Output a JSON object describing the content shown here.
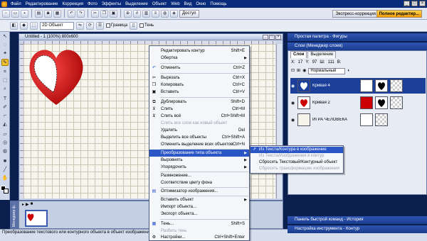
{
  "menubar": {
    "items": [
      "Файл",
      "Редактирование",
      "Коррекция",
      "Фото",
      "Эффекты",
      "Выделение",
      "Объект",
      "Web",
      "Вид",
      "Окно",
      "Помощь"
    ]
  },
  "toolbar": {
    "access_label": "Доступ",
    "express_label": "Экспресс-коррекция",
    "full_editor_label": "Полное редактир..."
  },
  "toolbar2": {
    "mode_value": "2D Объект",
    "border_label": "Граница",
    "shadow_label": "Тень"
  },
  "document": {
    "title": "Untitled - 1 (100%) 800x600"
  },
  "context_menu": {
    "items": [
      {
        "label": "Редактировать контур",
        "shortcut": "Shift+E",
        "disabled": false
      },
      {
        "label": "Обертка",
        "shortcut": "",
        "submenu": true,
        "disabled": false
      },
      {
        "label": "Отменить",
        "shortcut": "Ctrl+Z",
        "disabled": false
      },
      {
        "label": "Вырезать",
        "shortcut": "Ctrl+X",
        "disabled": false
      },
      {
        "label": "Копировать",
        "shortcut": "Ctrl+C",
        "disabled": false
      },
      {
        "label": "Вставить",
        "shortcut": "Ctrl+V",
        "disabled": false
      },
      {
        "label": "Дублировать",
        "shortcut": "Shift+D",
        "disabled": false
      },
      {
        "label": "Слить",
        "shortcut": "Ctrl+M",
        "disabled": false
      },
      {
        "label": "Слить всё",
        "shortcut": "Ctrl+Shift+M",
        "disabled": false
      },
      {
        "label": "Слить все слои как новый объект",
        "shortcut": "",
        "disabled": true
      },
      {
        "label": "Удалить",
        "shortcut": "Del",
        "disabled": false
      },
      {
        "label": "Выделить все объекты",
        "shortcut": "Ctrl+Shift+A",
        "disabled": false
      },
      {
        "label": "Отменить выделение всех объектов",
        "shortcut": "Ctrl+N",
        "disabled": false
      },
      {
        "label": "Преобразование типа объекта",
        "shortcut": "",
        "submenu": true,
        "highlighted": true,
        "disabled": false
      },
      {
        "label": "Выровнять",
        "shortcut": "",
        "submenu": true,
        "disabled": false
      },
      {
        "label": "Упорядочить",
        "shortcut": "",
        "submenu": true,
        "disabled": false
      },
      {
        "label": "Размножение...",
        "shortcut": "",
        "disabled": false
      },
      {
        "label": "Соответствие цвету фона",
        "shortcut": "",
        "disabled": false
      },
      {
        "label": "Оптимизатор изображения...",
        "shortcut": "",
        "disabled": false
      },
      {
        "label": "Вставить объект",
        "shortcut": "",
        "submenu": true,
        "disabled": false
      },
      {
        "label": "Импорт объекта...",
        "shortcut": "",
        "disabled": false
      },
      {
        "label": "Экспорт объекта...",
        "shortcut": "",
        "disabled": false
      },
      {
        "label": "Тень...",
        "shortcut": "Shift+S",
        "disabled": false
      },
      {
        "label": "Разбить тень",
        "shortcut": "",
        "disabled": true
      },
      {
        "label": "Настройки...",
        "shortcut": "Ctrl+Shift+Enter",
        "disabled": false
      }
    ]
  },
  "submenu": {
    "items": [
      {
        "label": "Из Текста/Контура в изображение",
        "highlighted": true,
        "disabled": false
      },
      {
        "label": "Из Текста/Изображения в контур",
        "disabled": true
      },
      {
        "label": "Сбросить Текстовый/Контурный объект",
        "disabled": false
      },
      {
        "label": "Сбросить трансформацию изображения",
        "disabled": true
      }
    ]
  },
  "panels": {
    "palette_title": "Простая палитра - Фигуры",
    "layers_title": "Слои (Менеджер слоев)",
    "tab_layers": "Слои",
    "tab_selection": "Выделение",
    "x_label": "X:",
    "x_value": "17",
    "y_label": "Y:",
    "y_value": "97",
    "w_label": "Ш:",
    "w_value": "111",
    "h_label": "В:",
    "blend_mode": "Нормальный",
    "history_title": "Панель быстрой команд - История",
    "tool_settings_title": "Настройка инструмента - Контур"
  },
  "layers": [
    {
      "name": "Кривая 4",
      "selected": true
    },
    {
      "name": "Кривая 2",
      "selected": false
    },
    {
      "name": "ИГРА ЧЕЛОВЕКА",
      "selected": false
    }
  ],
  "filmstrip": {
    "handle_label": "Менеджер ф..."
  },
  "statusbar": {
    "text": "Преобразование текстового или контурного объекта  в объект изображения"
  },
  "colors": {
    "menu_highlight": "#2a56c6",
    "title_bar": "#0a2b7a",
    "heart_red": "#d11a1a",
    "full_editor_accent": "#f2a000"
  }
}
